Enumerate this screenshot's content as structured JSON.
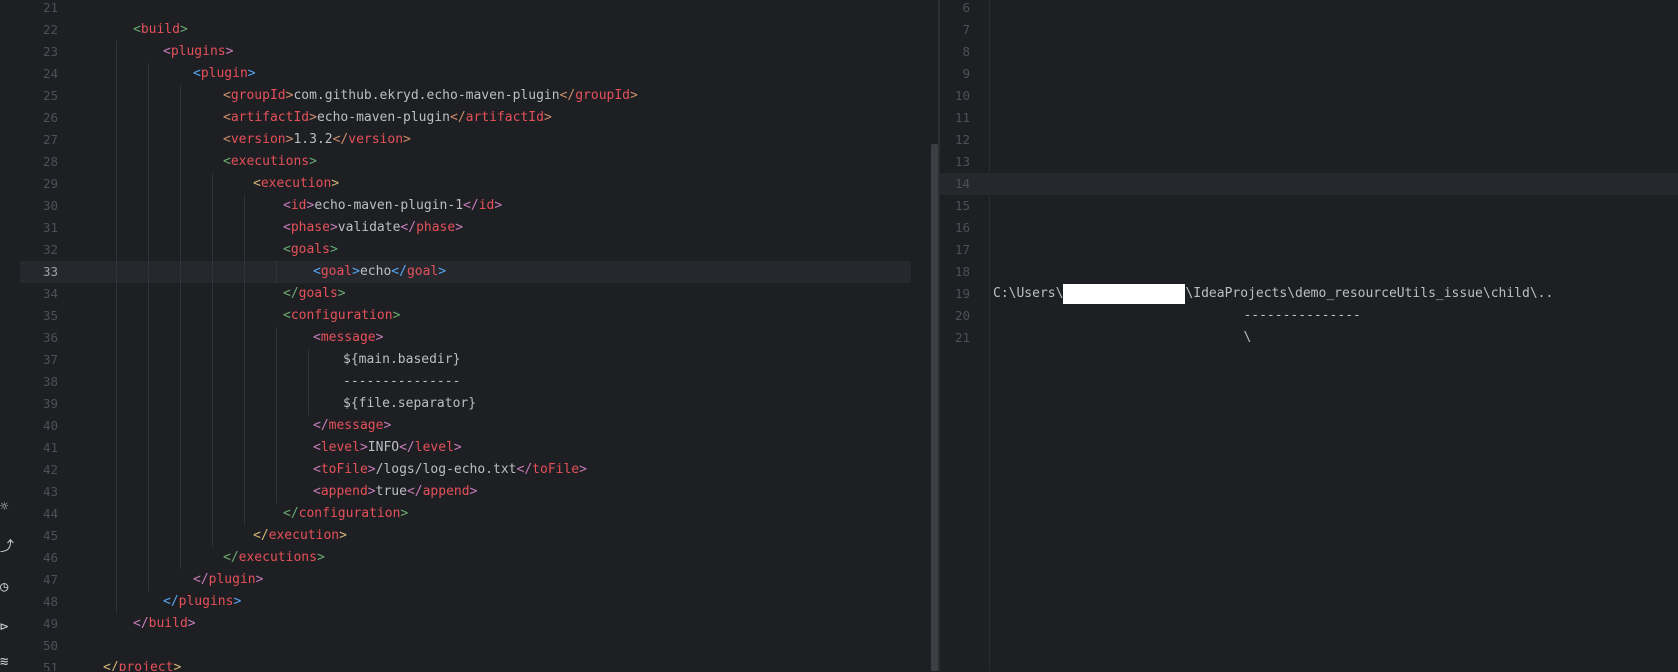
{
  "left_editor": {
    "current_line": "33",
    "lines": [
      {
        "n": "21",
        "indent": 0,
        "parts": []
      },
      {
        "n": "22",
        "indent": 1,
        "parts": [
          [
            "br-g",
            "<"
          ],
          [
            "tag-r",
            "build"
          ],
          [
            "br-g",
            ">"
          ]
        ]
      },
      {
        "n": "23",
        "indent": 2,
        "parts": [
          [
            "br-p",
            "<"
          ],
          [
            "tag-r",
            "plugins"
          ],
          [
            "br-p",
            ">"
          ]
        ]
      },
      {
        "n": "24",
        "indent": 3,
        "parts": [
          [
            "br-c",
            "<"
          ],
          [
            "tag-r",
            "plugin"
          ],
          [
            "br-c",
            ">"
          ]
        ]
      },
      {
        "n": "25",
        "indent": 4,
        "parts": [
          [
            "br-o",
            "<"
          ],
          [
            "tag-r",
            "groupId"
          ],
          [
            "br-o",
            ">"
          ],
          [
            "txt",
            "com.github.ekryd.echo-maven-plugin"
          ],
          [
            "br-o",
            "</"
          ],
          [
            "tag-r",
            "groupId"
          ],
          [
            "br-o",
            ">"
          ]
        ]
      },
      {
        "n": "26",
        "indent": 4,
        "parts": [
          [
            "br-o",
            "<"
          ],
          [
            "tag-r",
            "artifactId"
          ],
          [
            "br-o",
            ">"
          ],
          [
            "txt",
            "echo-maven-plugin"
          ],
          [
            "br-o",
            "</"
          ],
          [
            "tag-r",
            "artifactId"
          ],
          [
            "br-o",
            ">"
          ]
        ]
      },
      {
        "n": "27",
        "indent": 4,
        "parts": [
          [
            "br-o",
            "<"
          ],
          [
            "tag-r",
            "version"
          ],
          [
            "br-o",
            ">"
          ],
          [
            "txt",
            "1.3.2"
          ],
          [
            "br-o",
            "</"
          ],
          [
            "tag-r",
            "version"
          ],
          [
            "br-o",
            ">"
          ]
        ]
      },
      {
        "n": "28",
        "indent": 4,
        "parts": [
          [
            "br-g",
            "<"
          ],
          [
            "tag-r",
            "executions"
          ],
          [
            "br-g",
            ">"
          ]
        ]
      },
      {
        "n": "29",
        "indent": 5,
        "parts": [
          [
            "br-y",
            "<"
          ],
          [
            "tag-r",
            "execution"
          ],
          [
            "br-y",
            ">"
          ]
        ]
      },
      {
        "n": "30",
        "indent": 6,
        "parts": [
          [
            "br-p",
            "<"
          ],
          [
            "tag-r",
            "id"
          ],
          [
            "br-p",
            ">"
          ],
          [
            "txt",
            "echo-maven-plugin-1"
          ],
          [
            "br-p",
            "</"
          ],
          [
            "tag-r",
            "id"
          ],
          [
            "br-p",
            ">"
          ]
        ]
      },
      {
        "n": "31",
        "indent": 6,
        "parts": [
          [
            "br-p",
            "<"
          ],
          [
            "tag-r",
            "phase"
          ],
          [
            "br-p",
            ">"
          ],
          [
            "txt",
            "validate"
          ],
          [
            "br-p",
            "</"
          ],
          [
            "tag-r",
            "phase"
          ],
          [
            "br-p",
            ">"
          ]
        ]
      },
      {
        "n": "32",
        "indent": 6,
        "parts": [
          [
            "br-g",
            "<"
          ],
          [
            "tag-r",
            "goals"
          ],
          [
            "br-g",
            ">"
          ]
        ]
      },
      {
        "n": "33",
        "indent": 7,
        "parts": [
          [
            "br-c",
            "<"
          ],
          [
            "tag-r",
            "goal"
          ],
          [
            "br-c",
            ">"
          ],
          [
            "txt",
            "echo"
          ],
          [
            "br-c",
            "</"
          ],
          [
            "tag-r",
            "goal"
          ],
          [
            "br-c",
            ">"
          ]
        ]
      },
      {
        "n": "34",
        "indent": 6,
        "parts": [
          [
            "br-g",
            "</"
          ],
          [
            "tag-r",
            "goals"
          ],
          [
            "br-g",
            ">"
          ]
        ]
      },
      {
        "n": "35",
        "indent": 6,
        "parts": [
          [
            "br-g",
            "<"
          ],
          [
            "tag-r",
            "configuration"
          ],
          [
            "br-g",
            ">"
          ]
        ]
      },
      {
        "n": "36",
        "indent": 7,
        "parts": [
          [
            "br-p",
            "<"
          ],
          [
            "tag-r",
            "message"
          ],
          [
            "br-p",
            ">"
          ]
        ]
      },
      {
        "n": "37",
        "indent": 8,
        "parts": [
          [
            "txt",
            "${main.basedir}"
          ]
        ]
      },
      {
        "n": "38",
        "indent": 8,
        "parts": [
          [
            "txt",
            "---------------"
          ]
        ]
      },
      {
        "n": "39",
        "indent": 8,
        "parts": [
          [
            "txt",
            "${file.separator}"
          ]
        ]
      },
      {
        "n": "40",
        "indent": 7,
        "parts": [
          [
            "br-p",
            "</"
          ],
          [
            "tag-r",
            "message"
          ],
          [
            "br-p",
            ">"
          ]
        ]
      },
      {
        "n": "41",
        "indent": 7,
        "parts": [
          [
            "br-p",
            "<"
          ],
          [
            "tag-r",
            "level"
          ],
          [
            "br-p",
            ">"
          ],
          [
            "txt",
            "INFO"
          ],
          [
            "br-p",
            "</"
          ],
          [
            "tag-r",
            "level"
          ],
          [
            "br-p",
            ">"
          ]
        ]
      },
      {
        "n": "42",
        "indent": 7,
        "parts": [
          [
            "br-p",
            "<"
          ],
          [
            "tag-r",
            "toFile"
          ],
          [
            "br-p",
            ">"
          ],
          [
            "txt",
            "/logs/log-echo.txt"
          ],
          [
            "br-p",
            "</"
          ],
          [
            "tag-r",
            "toFile"
          ],
          [
            "br-p",
            ">"
          ]
        ]
      },
      {
        "n": "43",
        "indent": 7,
        "parts": [
          [
            "br-p",
            "<"
          ],
          [
            "tag-r",
            "append"
          ],
          [
            "br-p",
            ">"
          ],
          [
            "txt",
            "true"
          ],
          [
            "br-p",
            "</"
          ],
          [
            "tag-r",
            "append"
          ],
          [
            "br-p",
            ">"
          ]
        ]
      },
      {
        "n": "44",
        "indent": 6,
        "parts": [
          [
            "br-g",
            "</"
          ],
          [
            "tag-r",
            "configuration"
          ],
          [
            "br-g",
            ">"
          ]
        ]
      },
      {
        "n": "45",
        "indent": 5,
        "parts": [
          [
            "br-y",
            "</"
          ],
          [
            "tag-r",
            "execution"
          ],
          [
            "br-y",
            ">"
          ]
        ]
      },
      {
        "n": "46",
        "indent": 4,
        "parts": [
          [
            "br-g",
            "</"
          ],
          [
            "tag-r",
            "executions"
          ],
          [
            "br-g",
            ">"
          ]
        ]
      },
      {
        "n": "47",
        "indent": 3,
        "parts": [
          [
            "br-p",
            "</"
          ],
          [
            "tag-r",
            "plugin"
          ],
          [
            "br-p",
            ">"
          ]
        ]
      },
      {
        "n": "48",
        "indent": 2,
        "parts": [
          [
            "br-c",
            "</"
          ],
          [
            "tag-r",
            "plugins"
          ],
          [
            "br-c",
            ">"
          ]
        ]
      },
      {
        "n": "49",
        "indent": 1,
        "parts": [
          [
            "br-p",
            "</"
          ],
          [
            "tag-r",
            "build"
          ],
          [
            "br-p",
            ">"
          ]
        ]
      },
      {
        "n": "50",
        "indent": 0,
        "parts": []
      },
      {
        "n": "51",
        "indent": 0,
        "parts": [
          [
            "br-y",
            "</"
          ],
          [
            "tag-r",
            "project"
          ],
          [
            "br-y",
            ">"
          ]
        ]
      }
    ]
  },
  "right_editor": {
    "current_line": "14",
    "lines": [
      {
        "n": "6",
        "text": ""
      },
      {
        "n": "7",
        "text": ""
      },
      {
        "n": "8",
        "text": ""
      },
      {
        "n": "9",
        "text": ""
      },
      {
        "n": "10",
        "text": ""
      },
      {
        "n": "11",
        "text": ""
      },
      {
        "n": "12",
        "text": ""
      },
      {
        "n": "13",
        "text": ""
      },
      {
        "n": "14",
        "text": ""
      },
      {
        "n": "15",
        "text": ""
      },
      {
        "n": "16",
        "text": ""
      },
      {
        "n": "17",
        "text": ""
      },
      {
        "n": "18",
        "text": ""
      },
      {
        "n": "19",
        "prefix": "C:\\Users\\",
        "redacted": true,
        "suffix": "\\IdeaProjects\\demo_resourceUtils_issue\\child\\.."
      },
      {
        "n": "20",
        "text": "                                ---------------"
      },
      {
        "n": "21",
        "text": "                                \\"
      }
    ]
  },
  "toolbar_icons": [
    "debug-icon",
    "git-push-icon",
    "profiler-icon",
    "services-icon",
    "layers-icon"
  ],
  "colors": {
    "background": "#1e1f22",
    "tag": "#e5505a",
    "text": "#bcbec4",
    "line_number": "#4b5059"
  }
}
